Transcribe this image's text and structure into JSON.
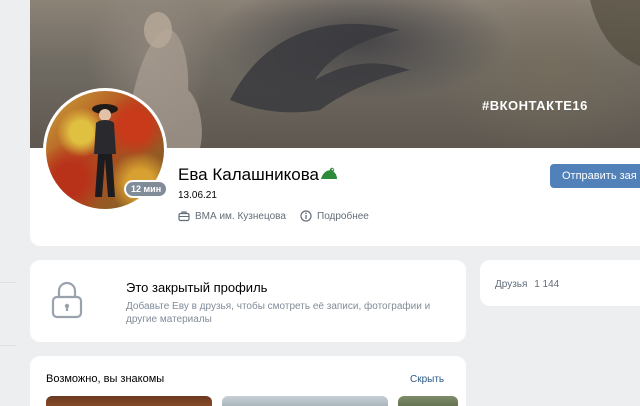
{
  "cover": {
    "hashtag": "#ВКОНТАКТЕ16"
  },
  "profile": {
    "name": "Ева Калашникова",
    "date": "13.06.21",
    "online": "12 мин",
    "university": "ВМА им. Кузнецова",
    "details": "Подробнее"
  },
  "actions": {
    "send_message": "Отправить зая"
  },
  "closed_profile": {
    "title": "Это закрытый профиль",
    "description": "Добавьте Еву в друзья, чтобы смотреть её записи, фотографии и другие материалы"
  },
  "friends": {
    "label": "Друзья",
    "count": "1 144"
  },
  "suggestions": {
    "title": "Возможно, вы знакомы",
    "hide": "Скрыть"
  },
  "colors": {
    "accent": "#5181b8",
    "muted": "#818c99",
    "link": "#2a5885",
    "bg": "#edeef0"
  }
}
